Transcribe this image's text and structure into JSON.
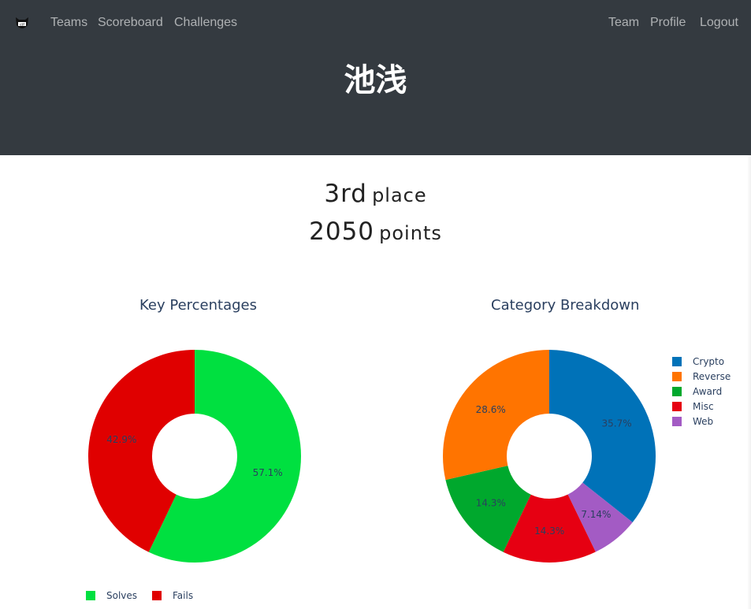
{
  "nav": {
    "logo_icon": "ctf-logo-icon",
    "left_links": [
      "Teams",
      "Scoreboard",
      "Challenges"
    ],
    "right_links": [
      "Team",
      "Profile",
      "Logout"
    ]
  },
  "team": {
    "name": "池浅"
  },
  "stats": {
    "place_value": "3rd",
    "place_label": "place",
    "points_value": "2050",
    "points_label": "points"
  },
  "chart_data": [
    {
      "type": "pie",
      "title": "Key Percentages",
      "hole": true,
      "slices": [
        {
          "label": "Solves",
          "value": 57.1,
          "text": "57.1%",
          "color": "#00e040"
        },
        {
          "label": "Fails",
          "value": 42.9,
          "text": "42.9%",
          "color": "#e00000"
        }
      ],
      "legend": [
        "Solves",
        "Fails"
      ],
      "legend_position": "bottom"
    },
    {
      "type": "pie",
      "title": "Category Breakdown",
      "hole": true,
      "slices": [
        {
          "label": "Crypto",
          "value": 35.7,
          "text": "35.7%",
          "color": "#0072b8"
        },
        {
          "label": "Web",
          "value": 7.14,
          "text": "7.14%",
          "color": "#a35bc4"
        },
        {
          "label": "Misc",
          "value": 14.3,
          "text": "14.3%",
          "color": "#e60012"
        },
        {
          "label": "Award",
          "value": 14.3,
          "text": "14.3%",
          "color": "#00a82d"
        },
        {
          "label": "Reverse",
          "value": 28.6,
          "text": "28.6%",
          "color": "#ff7400"
        }
      ],
      "legend": [
        "Crypto",
        "Reverse",
        "Award",
        "Misc",
        "Web"
      ],
      "legend_position": "right"
    }
  ]
}
